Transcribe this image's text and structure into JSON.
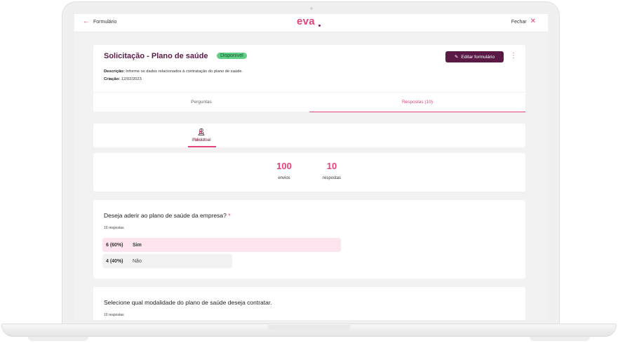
{
  "topbar": {
    "back_label": "Formulário",
    "logo": "eva",
    "close_label": "Fechar"
  },
  "form": {
    "title": "Solicitação - Plano de saúde",
    "status": "Disponível",
    "edit_button": "Editar formulário",
    "description_label": "Descrição:",
    "description": "Informe os dados relacionados à contratação do plano de saúde.",
    "created_label": "Criação:",
    "created": "12/02/2023"
  },
  "tabs": [
    {
      "label": "Perguntas",
      "active": false
    },
    {
      "label": "Respostas (10)",
      "active": true
    }
  ],
  "subtabs": [
    {
      "label": "Resumo",
      "icon": "bar-chart-icon",
      "active": true
    },
    {
      "label": "Individual",
      "icon": "user-icon",
      "active": false
    }
  ],
  "stats": [
    {
      "value": "100",
      "label": "envios"
    },
    {
      "value": "10",
      "label": "respostas"
    }
  ],
  "questions": [
    {
      "title": "Deseja aderir ao plano de saúde da empresa?",
      "required_mark": "*",
      "count_label": "10 respostas",
      "options": [
        {
          "pct": "6 (60%)",
          "label": "Sim",
          "fraction": 0.6
        },
        {
          "pct": "4 (40%)",
          "label": "Não",
          "fraction": 0.4
        }
      ]
    },
    {
      "title": "Selecione qual modalidade do plano de saúde deseja contratar.",
      "count_label": "10 respostas"
    }
  ],
  "colors": {
    "accent": "#e5437a",
    "primary": "#5b1a46",
    "status_green": "#5ecf86",
    "highlight_bar": "#fde4ee"
  }
}
